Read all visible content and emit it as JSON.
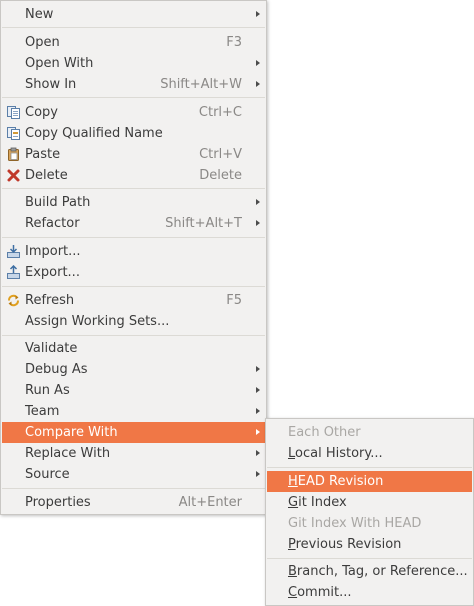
{
  "main_menu": {
    "items": [
      {
        "label": "New",
        "shortcut": "",
        "submenu": true
      },
      {
        "label": "Open",
        "shortcut": "F3",
        "submenu": false
      },
      {
        "label": "Open With",
        "shortcut": "",
        "submenu": true
      },
      {
        "label": "Show In",
        "shortcut": "Shift+Alt+W",
        "submenu": true
      },
      {
        "label": "Copy",
        "shortcut": "Ctrl+C",
        "icon": "copy-icon"
      },
      {
        "label": "Copy Qualified Name",
        "shortcut": "",
        "icon": "copy-qualified-name-icon"
      },
      {
        "label": "Paste",
        "shortcut": "Ctrl+V",
        "icon": "paste-icon"
      },
      {
        "label": "Delete",
        "shortcut": "Delete",
        "icon": "delete-icon"
      },
      {
        "label": "Build Path",
        "shortcut": "",
        "submenu": true
      },
      {
        "label": "Refactor",
        "shortcut": "Shift+Alt+T",
        "submenu": true
      },
      {
        "label": "Import...",
        "shortcut": "",
        "icon": "import-icon"
      },
      {
        "label": "Export...",
        "shortcut": "",
        "icon": "export-icon"
      },
      {
        "label": "Refresh",
        "shortcut": "F5",
        "icon": "refresh-icon"
      },
      {
        "label": "Assign Working Sets...",
        "shortcut": ""
      },
      {
        "label": "Validate",
        "shortcut": ""
      },
      {
        "label": "Debug As",
        "shortcut": "",
        "submenu": true
      },
      {
        "label": "Run As",
        "shortcut": "",
        "submenu": true
      },
      {
        "label": "Team",
        "shortcut": "",
        "submenu": true
      },
      {
        "label": "Compare With",
        "shortcut": "",
        "submenu": true,
        "active": true
      },
      {
        "label": "Replace With",
        "shortcut": "",
        "submenu": true
      },
      {
        "label": "Source",
        "shortcut": "",
        "submenu": true
      },
      {
        "label": "Properties",
        "shortcut": "Alt+Enter"
      }
    ]
  },
  "compare_submenu": {
    "items": [
      {
        "label": "Each Other",
        "disabled": true
      },
      {
        "label": "Local History...",
        "mnemonic": "L"
      },
      {
        "label": "HEAD Revision",
        "mnemonic": "H",
        "active": true
      },
      {
        "label": "Git Index",
        "mnemonic": "G"
      },
      {
        "label": "Git Index With HEAD",
        "disabled": true
      },
      {
        "label": "Previous Revision",
        "mnemonic": "P"
      },
      {
        "label": "Branch, Tag, or Reference...",
        "mnemonic": "B"
      },
      {
        "label": "Commit...",
        "mnemonic": "C"
      }
    ]
  },
  "colors": {
    "highlight": "#f07746",
    "menu_bg": "#f2f1f0",
    "text": "#3c3c3c",
    "disabled_text": "#a9a7a4",
    "delete_icon": "#c0392b"
  }
}
